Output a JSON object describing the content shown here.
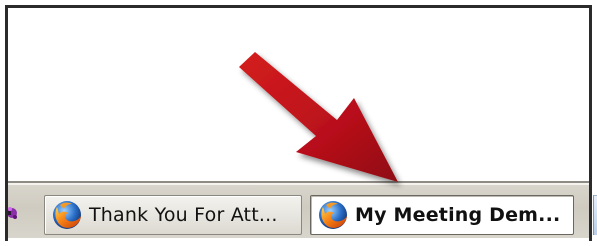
{
  "taskbar": {
    "buttons": [
      {
        "label": "Thank You For Att...",
        "icon": "firefox-icon",
        "active": false
      },
      {
        "label": "My Meeting Dem...",
        "icon": "firefox-icon",
        "active": true
      }
    ]
  },
  "annotation": {
    "arrow_color": "#c0141a"
  },
  "colors": {
    "taskbar": "#d4d0c8",
    "active_button": "#ffffff",
    "frame": "#2b2b2b"
  }
}
